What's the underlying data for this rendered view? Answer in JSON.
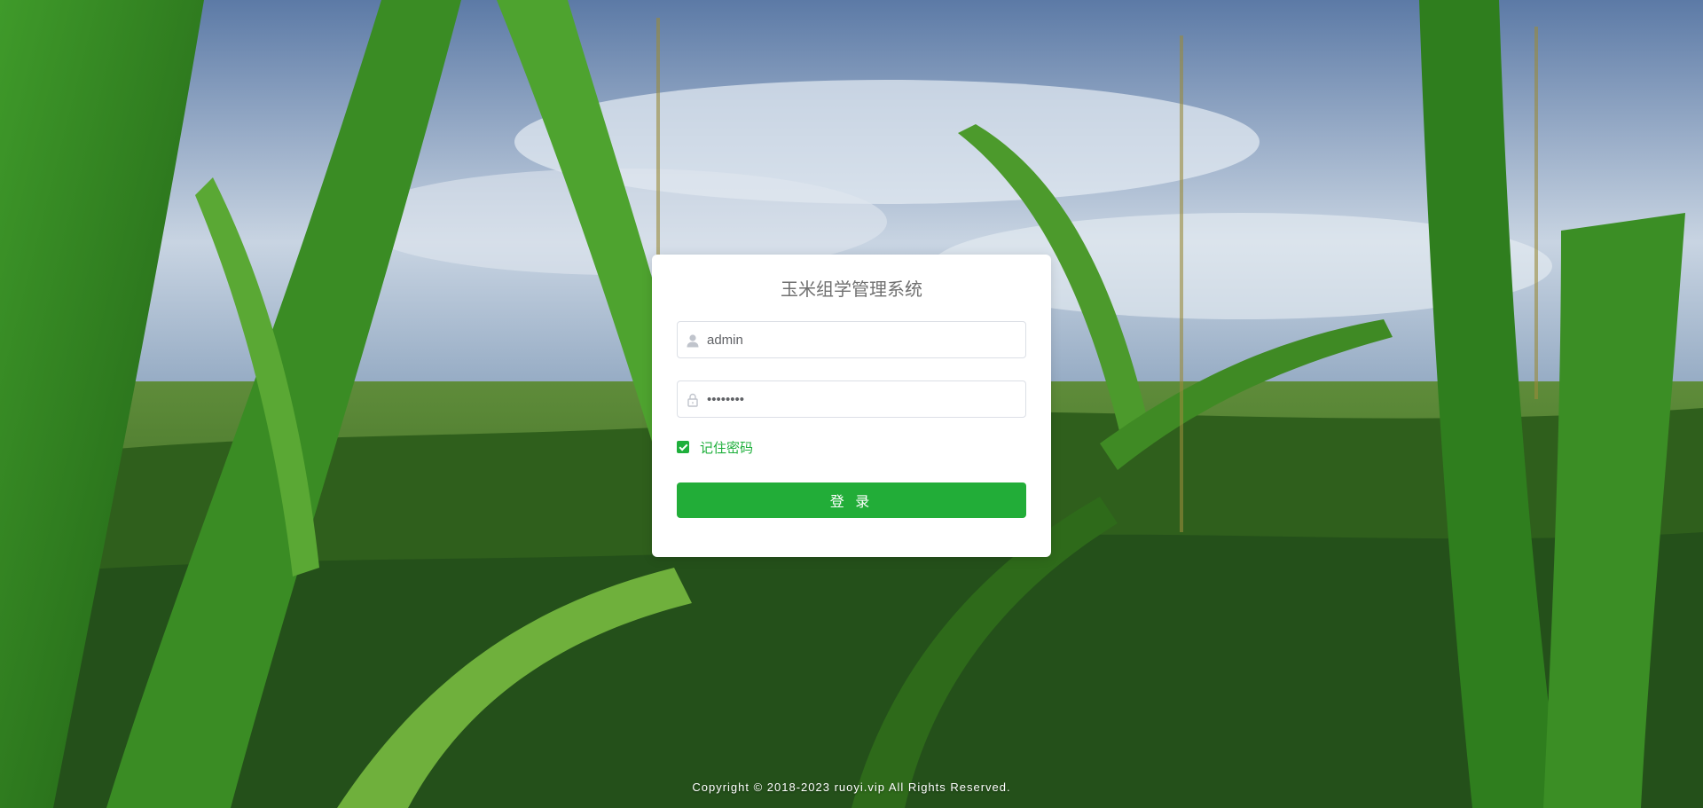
{
  "login": {
    "title": "玉米组学管理系统",
    "username_value": "admin",
    "password_value": "••••••••",
    "remember_label": "记住密码",
    "remember_checked": true,
    "submit_label": "登 录"
  },
  "footer": {
    "copyright": "Copyright © 2018-2023 ruoyi.vip All Rights Reserved."
  },
  "theme": {
    "accent": "#22ad38",
    "title_color": "#707070"
  },
  "icons": {
    "username": "user-icon",
    "password": "lock-icon"
  }
}
